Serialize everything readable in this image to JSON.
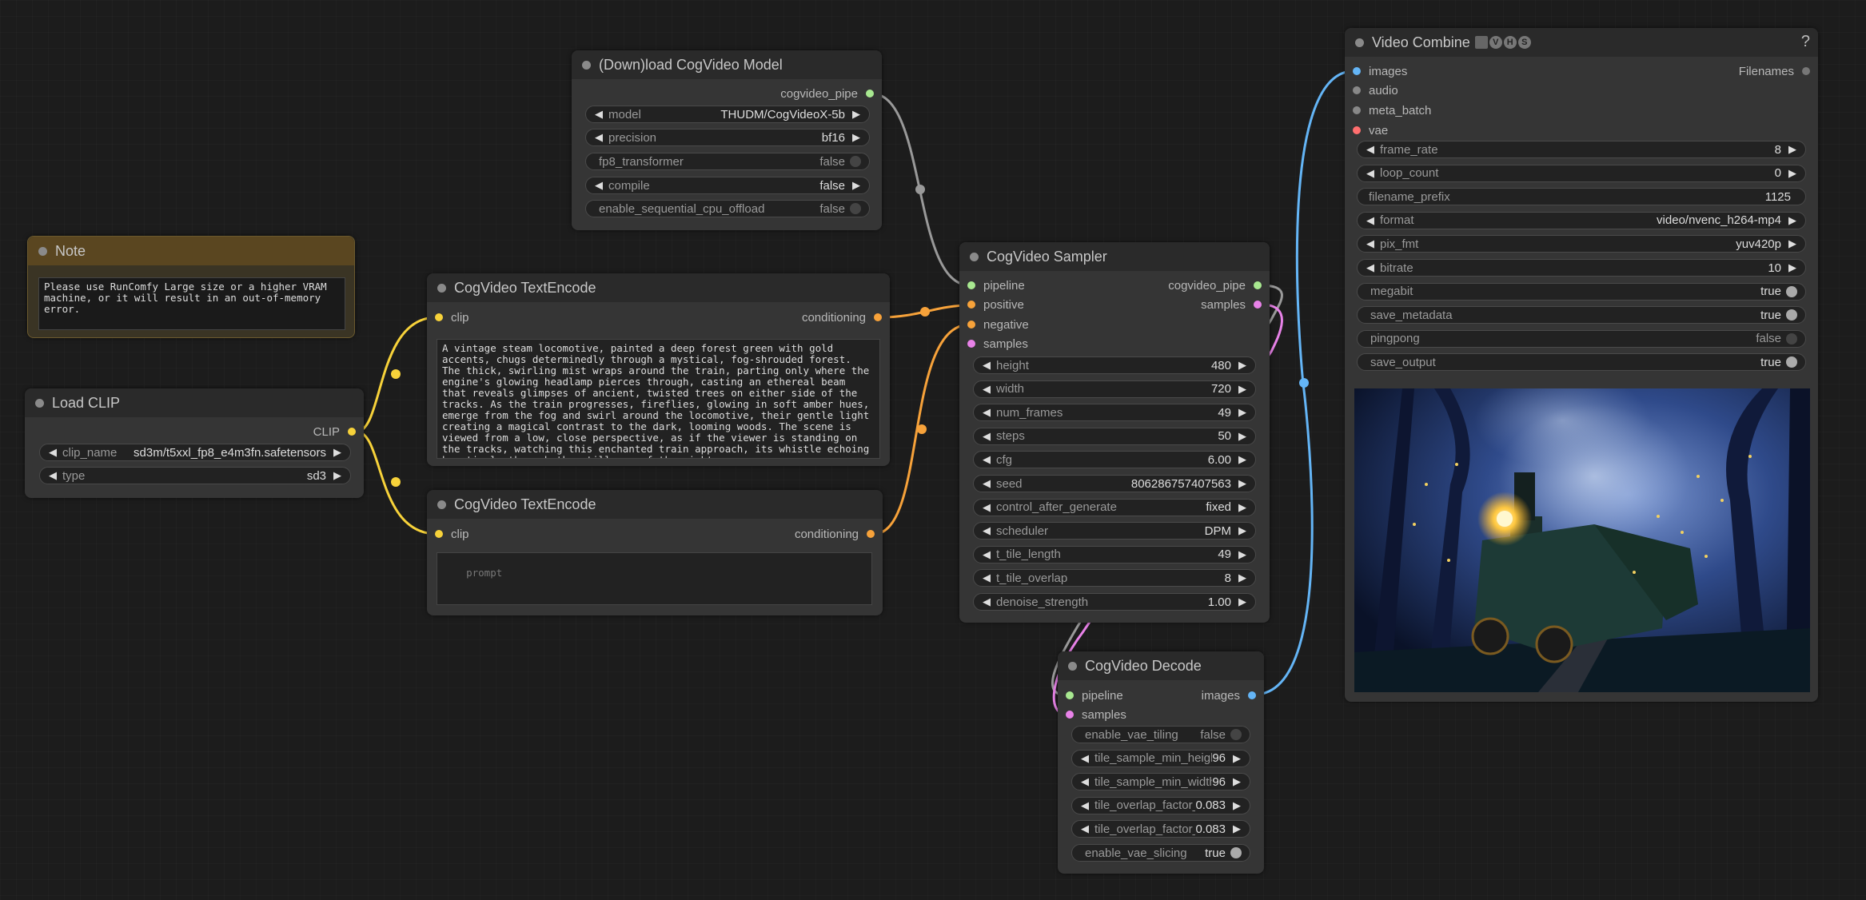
{
  "colors": {
    "clip": "#f7d23a",
    "conditioning": "#f7a23a",
    "latent": "#e882e8",
    "image": "#64b5f6",
    "pipe": "#a8e890",
    "vae": "#ff6e6e",
    "audio": "#888888"
  },
  "note": {
    "title": "Note",
    "text": "Please use RunComfy Large size or a higher VRAM machine, or it will result in an out-of-memory error."
  },
  "load_clip": {
    "title": "Load CLIP",
    "output_label": "CLIP",
    "widgets": [
      {
        "label": "clip_name",
        "value": "sd3m/t5xxl_fp8_e4m3fn.safetensors"
      },
      {
        "label": "type",
        "value": "sd3"
      }
    ]
  },
  "download_model": {
    "title": "(Down)load CogVideo Model",
    "output_label": "cogvideo_pipe",
    "widgets": [
      {
        "label": "model",
        "value": "THUDM/CogVideoX-5b",
        "kind": "combo"
      },
      {
        "label": "precision",
        "value": "bf16",
        "kind": "combo"
      },
      {
        "label": "fp8_transformer",
        "value": "false",
        "kind": "toggle"
      },
      {
        "label": "compile",
        "value": "false",
        "kind": "combo"
      },
      {
        "label": "enable_sequential_cpu_offload",
        "value": "false",
        "kind": "toggle"
      }
    ]
  },
  "text_encode_pos": {
    "title": "CogVideo TextEncode",
    "input_label": "clip",
    "output_label": "conditioning",
    "prompt": "A vintage steam locomotive, painted a deep forest green with gold accents, chugs determinedly through a mystical, fog-shrouded forest. The thick, swirling mist wraps around the train, parting only where the engine's glowing headlamp pierces through, casting an ethereal beam that reveals glimpses of ancient, twisted trees on either side of the tracks. As the train progresses, fireflies, glowing in soft amber hues, emerge from the fog and swirl around the locomotive, their gentle light creating a magical contrast to the dark, looming woods. The scene is viewed from a low, close perspective, as if the viewer is standing on the tracks, watching this enchanted train approach, its whistle echoing hauntingly through the stillness of the night."
  },
  "text_encode_neg": {
    "title": "CogVideo TextEncode",
    "input_label": "clip",
    "output_label": "conditioning",
    "placeholder": "prompt"
  },
  "sampler": {
    "title": "CogVideo Sampler",
    "inputs": [
      "pipeline",
      "positive",
      "negative",
      "samples"
    ],
    "outputs": [
      "cogvideo_pipe",
      "samples"
    ],
    "widgets": [
      {
        "label": "height",
        "value": "480"
      },
      {
        "label": "width",
        "value": "720"
      },
      {
        "label": "num_frames",
        "value": "49"
      },
      {
        "label": "steps",
        "value": "50"
      },
      {
        "label": "cfg",
        "value": "6.00"
      },
      {
        "label": "seed",
        "value": "806286757407563"
      },
      {
        "label": "control_after_generate",
        "value": "fixed"
      },
      {
        "label": "scheduler",
        "value": "DPM"
      },
      {
        "label": "t_tile_length",
        "value": "49"
      },
      {
        "label": "t_tile_overlap",
        "value": "8"
      },
      {
        "label": "denoise_strength",
        "value": "1.00"
      }
    ]
  },
  "decode": {
    "title": "CogVideo Decode",
    "inputs": [
      "pipeline",
      "samples"
    ],
    "outputs": [
      "images"
    ],
    "widgets": [
      {
        "label": "enable_vae_tiling",
        "value": "false",
        "kind": "toggle"
      },
      {
        "label": "tile_sample_min_height",
        "value": "96",
        "kind": "number"
      },
      {
        "label": "tile_sample_min_width",
        "value": "96",
        "kind": "number"
      },
      {
        "label": "tile_overlap_factor_height",
        "value": "0.083",
        "kind": "number"
      },
      {
        "label": "tile_overlap_factor_width",
        "value": "0.083",
        "kind": "number"
      },
      {
        "label": "enable_vae_slicing",
        "value": "true",
        "kind": "toggle"
      }
    ]
  },
  "video_combine": {
    "title": "Video Combine",
    "badge": [
      "🎥",
      "V",
      "H",
      "S"
    ],
    "help": "?",
    "inputs": [
      "images",
      "audio",
      "meta_batch",
      "vae"
    ],
    "outputs": [
      "Filenames"
    ],
    "widgets": [
      {
        "label": "frame_rate",
        "value": "8",
        "kind": "number"
      },
      {
        "label": "loop_count",
        "value": "0",
        "kind": "number"
      },
      {
        "label": "filename_prefix",
        "value": "1125",
        "kind": "text"
      },
      {
        "label": "format",
        "value": "video/nvenc_h264-mp4",
        "kind": "combo"
      },
      {
        "label": "pix_fmt",
        "value": "yuv420p",
        "kind": "combo"
      },
      {
        "label": "bitrate",
        "value": "10",
        "kind": "number"
      },
      {
        "label": "megabit",
        "value": "true",
        "kind": "toggle"
      },
      {
        "label": "save_metadata",
        "value": "true",
        "kind": "toggle"
      },
      {
        "label": "pingpong",
        "value": "false",
        "kind": "toggle"
      },
      {
        "label": "save_output",
        "value": "true",
        "kind": "toggle"
      }
    ],
    "preview_alt": "steam locomotive in foggy forest preview"
  }
}
